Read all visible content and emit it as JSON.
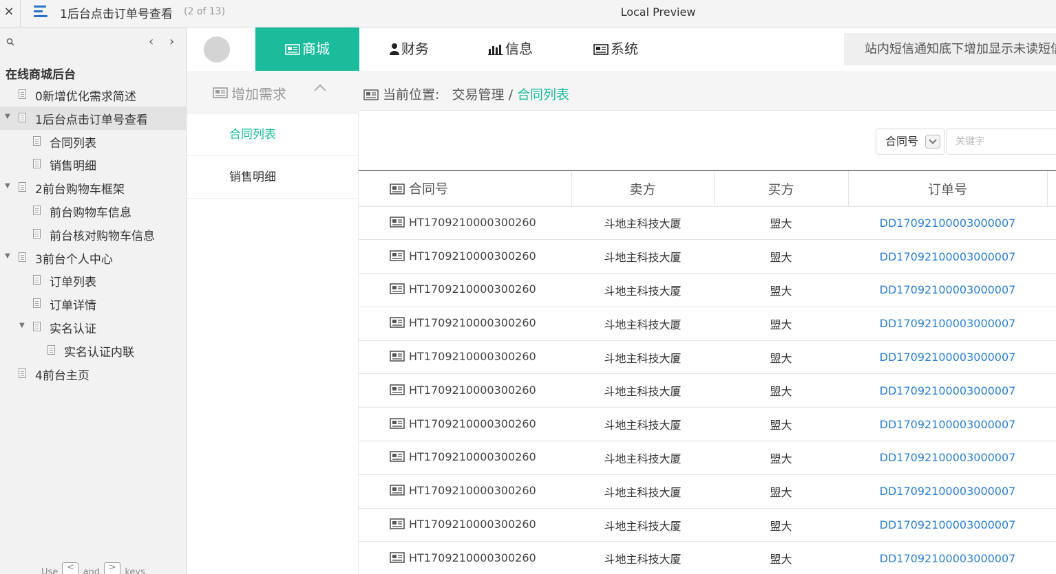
{
  "topbar": {
    "close": "×",
    "page_name": "1后台点击订单号查看",
    "page_count": "(2 of 13)",
    "preview": "Local Preview"
  },
  "sidebar": {
    "search_icon": "⚲",
    "prev": "‹",
    "next": "›",
    "project": "在线商城后台",
    "items": [
      {
        "label": "0新增优化需求简述",
        "level": 0,
        "arrow": ""
      },
      {
        "label": "1后台点击订单号查看",
        "level": 0,
        "arrow": "▼",
        "active": true
      },
      {
        "label": "合同列表",
        "level": 1,
        "arrow": ""
      },
      {
        "label": "销售明细",
        "level": 1,
        "arrow": ""
      },
      {
        "label": "2前台购物车框架",
        "level": 0,
        "arrow": "▼"
      },
      {
        "label": "前台购物车信息",
        "level": 1,
        "arrow": ""
      },
      {
        "label": "前台核对购物车信息",
        "level": 1,
        "arrow": ""
      },
      {
        "label": "3前台个人中心",
        "level": 0,
        "arrow": "▼"
      },
      {
        "label": "订单列表",
        "level": 1,
        "arrow": ""
      },
      {
        "label": "订单详情",
        "level": 1,
        "arrow": ""
      },
      {
        "label": "实名认证",
        "level": 1,
        "arrow": "▼"
      },
      {
        "label": "实名认证内联",
        "level": 2,
        "arrow": ""
      },
      {
        "label": "4前台主页",
        "level": 0,
        "arrow": ""
      }
    ],
    "footer": {
      "use": "Use",
      "key_prev": "<",
      "and": "and",
      "key_next": ">",
      "keys": "keys"
    }
  },
  "header": {
    "tabs": [
      {
        "label": "商城",
        "icon": "newspaper-icon",
        "active": true
      },
      {
        "label": "财务",
        "icon": "user-icon"
      },
      {
        "label": "信息",
        "icon": "bar-chart-icon"
      },
      {
        "label": "系统",
        "icon": "newspaper-icon"
      }
    ],
    "notice": "站内短信通知底下增加显示未读短信"
  },
  "subnav": {
    "group_label": "增加需求",
    "items": [
      {
        "label": "合同列表",
        "active": true
      },
      {
        "label": "销售明细"
      }
    ]
  },
  "breadcrumb": {
    "prefix": "当前位置:",
    "parent": "交易管理",
    "separator": " / ",
    "current": "合同列表"
  },
  "filter": {
    "select_value": "合同号",
    "keyword_placeholder": "关键字"
  },
  "table": {
    "columns": [
      "合同号",
      "卖方",
      "买方",
      "订单号"
    ],
    "rows": [
      [
        "HT1709210000300260",
        "斗地主科技大厦",
        "盟大",
        "DD17092100003000007"
      ],
      [
        "HT1709210000300260",
        "斗地主科技大厦",
        "盟大",
        "DD17092100003000007"
      ],
      [
        "HT1709210000300260",
        "斗地主科技大厦",
        "盟大",
        "DD17092100003000007"
      ],
      [
        "HT1709210000300260",
        "斗地主科技大厦",
        "盟大",
        "DD17092100003000007"
      ],
      [
        "HT1709210000300260",
        "斗地主科技大厦",
        "盟大",
        "DD17092100003000007"
      ],
      [
        "HT1709210000300260",
        "斗地主科技大厦",
        "盟大",
        "DD17092100003000007"
      ],
      [
        "HT1709210000300260",
        "斗地主科技大厦",
        "盟大",
        "DD17092100003000007"
      ],
      [
        "HT1709210000300260",
        "斗地主科技大厦",
        "盟大",
        "DD17092100003000007"
      ],
      [
        "HT1709210000300260",
        "斗地主科技大厦",
        "盟大",
        "DD17092100003000007"
      ],
      [
        "HT1709210000300260",
        "斗地主科技大厦",
        "盟大",
        "DD17092100003000007"
      ],
      [
        "HT1709210000300260",
        "斗地主科技大厦",
        "盟大",
        "DD17092100003000007"
      ]
    ]
  },
  "colors": {
    "accent": "#1abc9c",
    "link": "#2a7fd4",
    "menu_icon": "#2a6fc9"
  }
}
